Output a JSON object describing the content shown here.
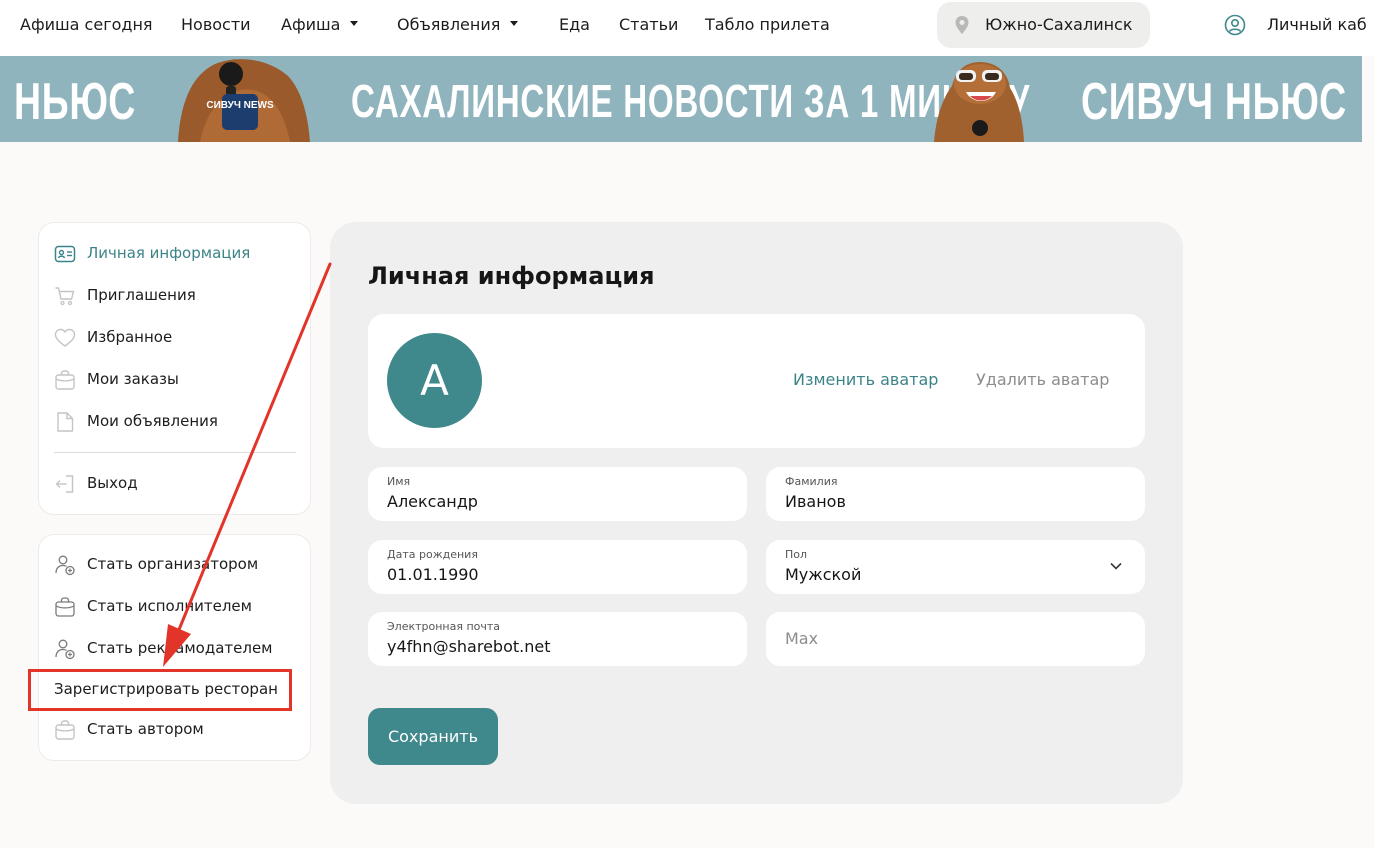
{
  "nav": {
    "items": [
      {
        "label": "Афиша сегодня",
        "dropdown": false
      },
      {
        "label": "Новости",
        "dropdown": false
      },
      {
        "label": "Афиша",
        "dropdown": true
      },
      {
        "label": "Объявления",
        "dropdown": true
      },
      {
        "label": "Еда",
        "dropdown": false
      },
      {
        "label": "Статьи",
        "dropdown": false
      },
      {
        "label": "Табло прилета",
        "dropdown": false
      }
    ],
    "city": "Южно-Сахалинск",
    "city_icon": "map-pin-icon",
    "account_label": "Личный каб",
    "account_icon": "user-circle-icon"
  },
  "banner": {
    "left_text": "НЬЮС",
    "middle_text": "САХАЛИНСКИЕ НОВОСТИ ЗА 1 МИНУТУ",
    "right_text": "СИВУЧ НЬЮС",
    "mic_badge": "СИВУЧ NEWS",
    "background_color": "#8fb4bd"
  },
  "sidebar": {
    "menu": [
      {
        "label": "Личная информация",
        "icon": "id-card-icon",
        "active": true
      },
      {
        "label": "Приглашения",
        "icon": "cart-icon",
        "active": false
      },
      {
        "label": "Избранное",
        "icon": "heart-icon",
        "active": false
      },
      {
        "label": "Мои заказы",
        "icon": "bag-icon",
        "active": false
      },
      {
        "label": "Мои объявления",
        "icon": "document-icon",
        "active": false
      }
    ],
    "logout": {
      "label": "Выход",
      "icon": "logout-icon"
    },
    "roles": [
      {
        "label": "Стать организатором",
        "icon": "user-plus-icon"
      },
      {
        "label": "Стать исполнителем",
        "icon": "briefcase-icon"
      },
      {
        "label": "Стать рекламодателем",
        "icon": "user-plus-icon"
      },
      {
        "label": "Зарегистрировать ресторан",
        "icon": ""
      },
      {
        "label": "Стать автором",
        "icon": "bag-icon"
      }
    ]
  },
  "main": {
    "title": "Личная информация",
    "avatar": {
      "initial": "А",
      "change_label": "Изменить аватар",
      "delete_label": "Удалить аватар",
      "color": "#3f888b"
    },
    "fields": {
      "first_name": {
        "label": "Имя",
        "value": "Александр"
      },
      "last_name": {
        "label": "Фамилия",
        "value": "Иванов"
      },
      "birth_date": {
        "label": "Дата рождения",
        "value": "01.01.1990"
      },
      "gender": {
        "label": "Пол",
        "value": "Мужской"
      },
      "email": {
        "label": "Электронная почта",
        "value": "y4fhn@sharebot.net"
      },
      "extra": {
        "placeholder": "Max"
      }
    },
    "save_label": "Сохранить"
  },
  "colors": {
    "accent": "#3f888b",
    "active_text": "#3c8388",
    "annotation": "#e3342a"
  }
}
